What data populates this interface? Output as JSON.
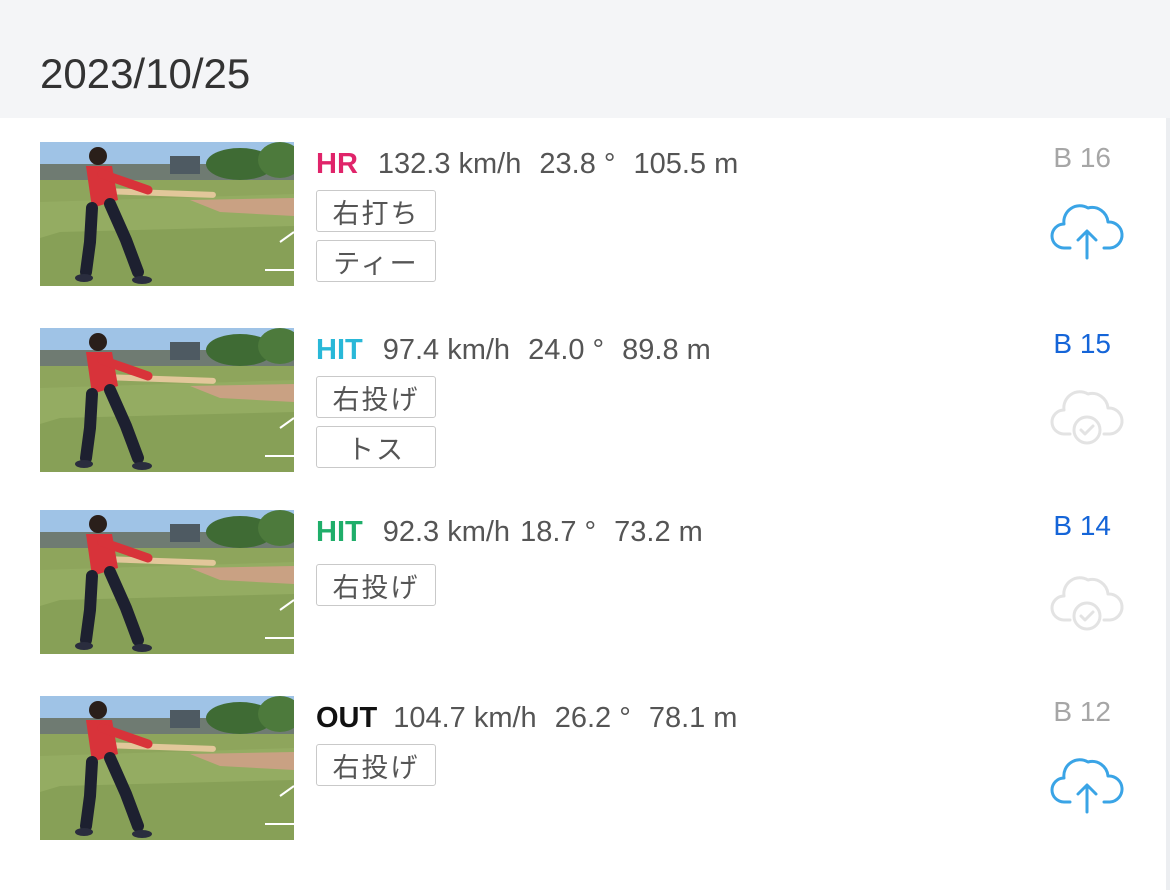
{
  "header": {
    "date": "2023/10/25"
  },
  "colors": {
    "hr": "#e0246a",
    "hit_cyan": "#29b8d8",
    "hit_green": "#1fae6a",
    "out": "#111111",
    "batno_grey": "#a6a6a6",
    "batno_blue": "#1565d8",
    "upload_icon": "#3aa4e6",
    "synced_icon": "#e3e3e3"
  },
  "items": [
    {
      "result": "HR",
      "speed": "132.3 km/h",
      "angle": "23.8 °",
      "distance": "105.5 m",
      "tags": [
        "右打ち",
        "ティー"
      ],
      "bat_no": "B 16",
      "status_icon": "cloud-upload-icon"
    },
    {
      "result": "HIT",
      "speed": "97.4 km/h",
      "angle": "24.0 °",
      "distance": "89.8 m",
      "tags": [
        "右投げ",
        "トス"
      ],
      "bat_no": "B 15",
      "status_icon": "cloud-synced-icon"
    },
    {
      "result": "HIT",
      "speed": "92.3 km/h",
      "angle": "18.7 °",
      "distance": "73.2 m",
      "tags": [
        "右投げ"
      ],
      "bat_no": "B 14",
      "status_icon": "cloud-synced-icon"
    },
    {
      "result": "OUT",
      "speed": "104.7 km/h",
      "angle": "26.2 °",
      "distance": "78.1 m",
      "tags": [
        "右投げ"
      ],
      "bat_no": "B 12",
      "status_icon": "cloud-upload-icon"
    }
  ]
}
